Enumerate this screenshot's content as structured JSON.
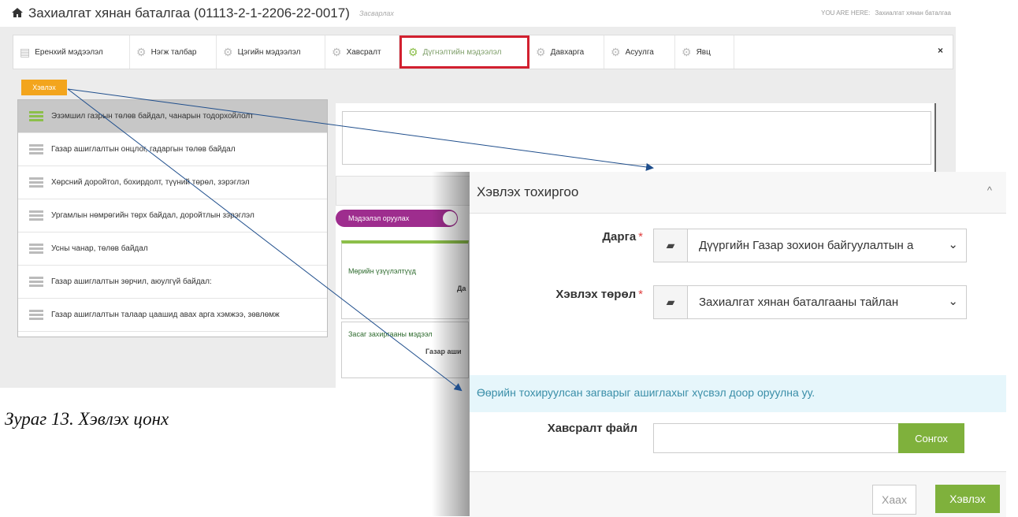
{
  "header": {
    "title": "Захиалгат хянан баталгаа (01113-2-1-2206-22-0017)",
    "subtitle": "Засварлах",
    "you_are_here_label": "YOU ARE HERE:",
    "you_are_here_value": "Захиалгат хянан баталгаа"
  },
  "tabs": [
    {
      "label": "Еренхий мэдээлэл",
      "icon": "document-icon"
    },
    {
      "label": "Нэгж талбар",
      "icon": "gears-icon"
    },
    {
      "label": "Цэгийн мэдээлэл",
      "icon": "gears-icon"
    },
    {
      "label": "Хавсралт",
      "icon": "gears-icon"
    },
    {
      "label": "Дүгнэлтийн мэдээлэл",
      "icon": "gears-icon"
    },
    {
      "label": "Давхарга",
      "icon": "gears-icon"
    },
    {
      "label": "Асуулга",
      "icon": "gears-icon"
    },
    {
      "label": "Явц",
      "icon": "gears-icon"
    }
  ],
  "active_tab": "Дүгнэлтийн мэдээлэл",
  "tab_close": "×",
  "print_button": "Хэвлэх",
  "list_items": [
    "Эзэмшил газрын төлөв байдал, чанарын тодорхойлолт",
    "Газар ашиглалтын онцлог, гадаргын төлөв байдал",
    "Хөрсний доройтол, бохирдолт, түүний төрөл, зэрэглэл",
    "Ургамлын нөмрөгийн төрх байдал, доройтлын зэрэглэл",
    "Усны чанар, төлөв байдал",
    "Газар ашиглалтын зөрчил, аюулгүй байдал:",
    "Газар ашиглалтын талаар цаашид авах арга хэмжээ, зөвлөмж"
  ],
  "toggle_label": "Мэдээлэл оруулах",
  "card1": {
    "title": "Мөрийн үзүүлэлтүүд",
    "value": "Да"
  },
  "card2": {
    "title": "Засаг захиргааны мэдээл",
    "value": "Газар аши"
  },
  "caption": "Зураг 13. Хэвлэх цонх",
  "modal": {
    "title": "Хэвлэх тохиргоо",
    "collapse": "^",
    "field1_label": "Дарга",
    "field1_value": "Дүүргийн Газар зохион байгуулалтын а",
    "field2_label": "Хэвлэх төрөл",
    "field2_value": "Захиалгат хянан баталгааны тайлан",
    "required_mark": "*",
    "info_text": "Өөрийн тохируулсан загварыг ашиглахыг хүсвэл доор оруулна уу.",
    "attach_label": "Хавсралт файл",
    "choose_button": "Сонгох",
    "close_button": "Хаах",
    "print_button": "Хэвлэх"
  },
  "colors": {
    "active_tab_border": "#d2202f",
    "print_btn": "#f3a51d",
    "green": "#7fb13c",
    "toggle": "#9e2d8e",
    "arrow": "#1f4e8c"
  }
}
